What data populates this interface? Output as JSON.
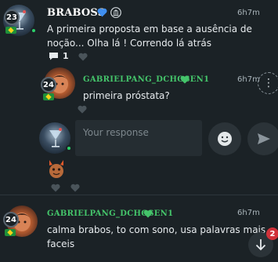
{
  "comment1": {
    "username": "BRABOSS",
    "level": "23",
    "time": "6h7m",
    "text_line1": "A primeira proposta em base a ausência de",
    "text_line2": "noção... Olha lá ! Correndo lá atrás",
    "reply_count": "1"
  },
  "reply1": {
    "username": "GABRIELPANG_DCHOSEN1",
    "level": "24",
    "time": "6h7m",
    "text": "primeira próstata?"
  },
  "composer": {
    "placeholder": "Your response"
  },
  "comment2": {
    "username": "GABRIELPANG_DCHOSEN1",
    "level": "24",
    "time": "6h7m",
    "text_line1": "calma brabos, to com sono, usa palavras mais",
    "text_line2": "faceis"
  },
  "notifications": {
    "count": "2"
  },
  "colors": {
    "background": "#1b2226",
    "verified_blue": "#3f8ff0",
    "username_green": "#44c46a",
    "notification_red": "#d1323a"
  }
}
